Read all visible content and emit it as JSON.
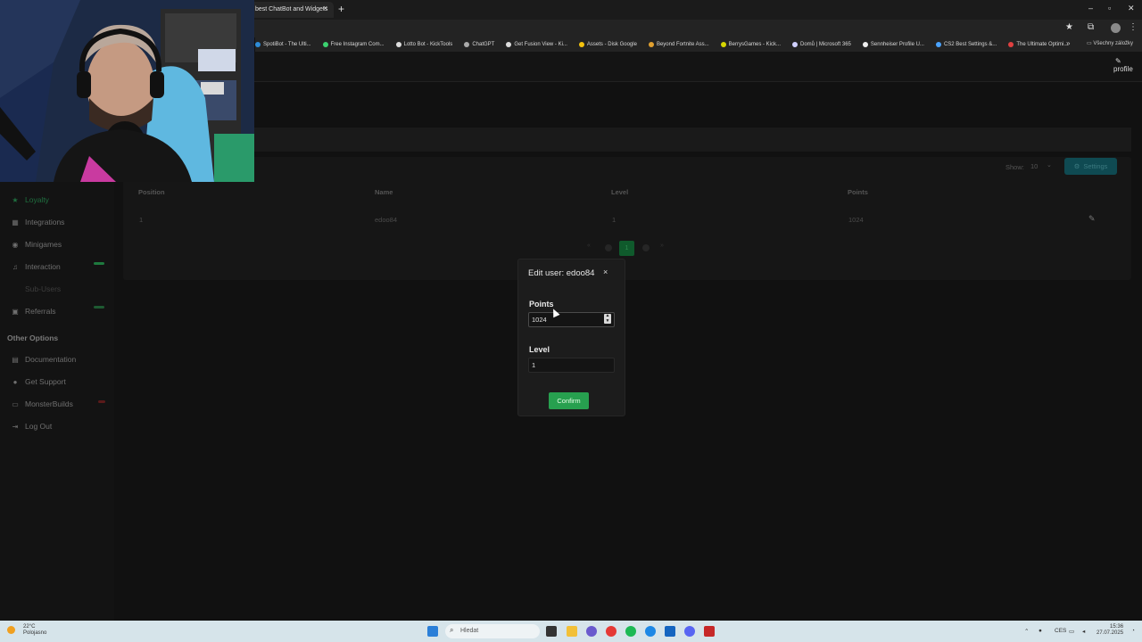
{
  "browser": {
    "tab_title": "best ChatBot and Widgets",
    "tab_close": "×",
    "new_tab": "+",
    "window_controls": [
      "–",
      "▫",
      "✕"
    ],
    "bookmarks": [
      {
        "label": "SpotiBot - The Ulti...",
        "color": "#2e8bd8"
      },
      {
        "label": "Free Instagram Com...",
        "color": "#3bd16f"
      },
      {
        "label": "Lotto Bot - KickTools",
        "color": "#dddddd"
      },
      {
        "label": "ChatGPT",
        "color": "#aaaaaa"
      },
      {
        "label": "Get Fusion View - Ki...",
        "color": "#dddddd"
      },
      {
        "label": "Assets - Disk Google",
        "color": "#f4c20d"
      },
      {
        "label": "Beyond Fortnite Ass...",
        "color": "#e0a030"
      },
      {
        "label": "BerrysGames - Kick...",
        "color": "#d6d600"
      },
      {
        "label": "Domů | Microsoft 365",
        "color": "#d0d0ff"
      },
      {
        "label": "Sennheiser Profile U...",
        "color": "#eeeeee"
      },
      {
        "label": "CS2 Best Settings &...",
        "color": "#4aa3ff"
      },
      {
        "label": "The Ultimate Optimi...",
        "color": "#e04040"
      }
    ],
    "bookmarks_more": "»",
    "bookmarks_folder": "Všechny záložky"
  },
  "header": {
    "profile_label": "profile"
  },
  "sidebar": {
    "items": [
      {
        "label": "Loyalty",
        "icon": "star-icon",
        "glyph": "★",
        "state": "active"
      },
      {
        "label": "Integrations",
        "icon": "grid-icon",
        "glyph": "▦",
        "state": "normal"
      },
      {
        "label": "Minigames",
        "icon": "gamepad-icon",
        "glyph": "◉",
        "state": "normal"
      },
      {
        "label": "Interaction",
        "icon": "music-icon",
        "glyph": "♫",
        "state": "normal"
      },
      {
        "label": "Sub-Users",
        "icon": "users-icon",
        "glyph": "",
        "state": "dim"
      },
      {
        "label": "Referrals",
        "icon": "referral-icon",
        "glyph": "▣",
        "state": "normal"
      }
    ],
    "other_title": "Other Options",
    "other_items": [
      {
        "label": "Documentation",
        "icon": "book-icon",
        "glyph": "▤"
      },
      {
        "label": "Get Support",
        "icon": "support-icon",
        "glyph": "●"
      },
      {
        "label": "MonsterBuilds",
        "icon": "monitor-icon",
        "glyph": "▭"
      },
      {
        "label": "Log Out",
        "icon": "logout-icon",
        "glyph": "⇥"
      }
    ],
    "badge_colors": {
      "interaction": "#1e7a3e",
      "referrals": "#1e5a32",
      "monsterbuilds": "#5a1a1a"
    }
  },
  "table": {
    "show_label": "Show:",
    "show_value": "10",
    "settings_label": "Settings",
    "columns": [
      "Position",
      "Name",
      "Level",
      "Points"
    ],
    "rows": [
      {
        "position": "1",
        "name": "edoo84",
        "level": "1",
        "points": "1024"
      }
    ],
    "pager": {
      "first": "«",
      "prev": "‹",
      "current": "1",
      "next": "›",
      "last": "»"
    }
  },
  "modal": {
    "title": "Edit user: edoo84",
    "close": "×",
    "points_label": "Points",
    "points_value": "1024",
    "level_label": "Level",
    "level_value": "1",
    "confirm_label": "Confirm"
  },
  "taskbar": {
    "weather_temp": "22°C",
    "weather_desc": "Polojasno",
    "search_placeholder": "Hledat",
    "language": "CES",
    "time": "15:36",
    "date": "27.07.2025"
  },
  "colors": {
    "accent_green": "#27a04f",
    "settings_teal": "#0f4a52",
    "taskbar_bg": "#d6e4ea"
  }
}
